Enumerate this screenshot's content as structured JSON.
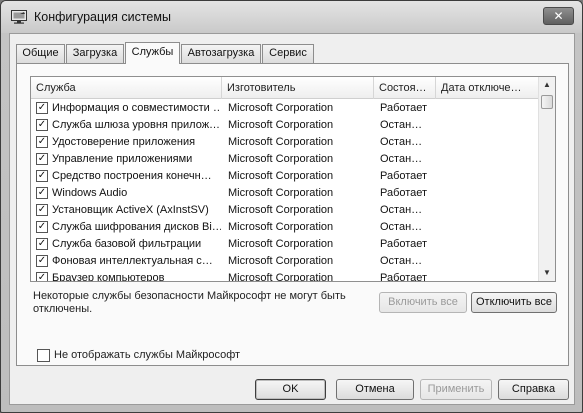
{
  "window": {
    "title": "Конфигурация системы",
    "close_glyph": "✕"
  },
  "tabs": [
    {
      "label": "Общие",
      "active": false
    },
    {
      "label": "Загрузка",
      "active": false
    },
    {
      "label": "Службы",
      "active": true
    },
    {
      "label": "Автозагрузка",
      "active": false
    },
    {
      "label": "Сервис",
      "active": false
    }
  ],
  "services_table": {
    "columns": [
      "Служба",
      "Изготовитель",
      "Состоя…",
      "Дата отключе…"
    ],
    "rows": [
      {
        "checked": true,
        "service": "Информация о совместимости …",
        "manufacturer": "Microsoft Corporation",
        "status": "Работает",
        "date_disabled": ""
      },
      {
        "checked": true,
        "service": "Служба шлюза уровня прилож…",
        "manufacturer": "Microsoft Corporation",
        "status": "Остан…",
        "date_disabled": ""
      },
      {
        "checked": true,
        "service": "Удостоверение приложения",
        "manufacturer": "Microsoft Corporation",
        "status": "Остан…",
        "date_disabled": ""
      },
      {
        "checked": true,
        "service": "Управление приложениями",
        "manufacturer": "Microsoft Corporation",
        "status": "Остан…",
        "date_disabled": ""
      },
      {
        "checked": true,
        "service": "Средство построения конечн…",
        "manufacturer": "Microsoft Corporation",
        "status": "Работает",
        "date_disabled": ""
      },
      {
        "checked": true,
        "service": "Windows Audio",
        "manufacturer": "Microsoft Corporation",
        "status": "Работает",
        "date_disabled": ""
      },
      {
        "checked": true,
        "service": "Установщик ActiveX (AxInstSV)",
        "manufacturer": "Microsoft Corporation",
        "status": "Остан…",
        "date_disabled": ""
      },
      {
        "checked": true,
        "service": "Служба шифрования дисков Bi…",
        "manufacturer": "Microsoft Corporation",
        "status": "Остан…",
        "date_disabled": ""
      },
      {
        "checked": true,
        "service": "Служба базовой фильтрации",
        "manufacturer": "Microsoft Corporation",
        "status": "Работает",
        "date_disabled": ""
      },
      {
        "checked": true,
        "service": "Фоновая интеллектуальная с…",
        "manufacturer": "Microsoft Corporation",
        "status": "Остан…",
        "date_disabled": ""
      },
      {
        "checked": true,
        "service": "Браузер компьютеров",
        "manufacturer": "Microsoft Corporation",
        "status": "Работает",
        "date_disabled": ""
      }
    ],
    "scroll_up_glyph": "▲",
    "scroll_down_glyph": "▼"
  },
  "security_note": "Некоторые службы безопасности Майкрософт не могут быть отключены.",
  "enable_all_label": "Включить все",
  "disable_all_label": "Отключить все",
  "hide_ms_services": {
    "label": "Не отображать службы Майкрософт",
    "checked": false
  },
  "dialog_buttons": {
    "ok": "OK",
    "cancel": "Отмена",
    "apply": "Применить",
    "help": "Справка"
  },
  "icons": {
    "title": "msconfig-icon",
    "checkbox_mark": "✓"
  }
}
